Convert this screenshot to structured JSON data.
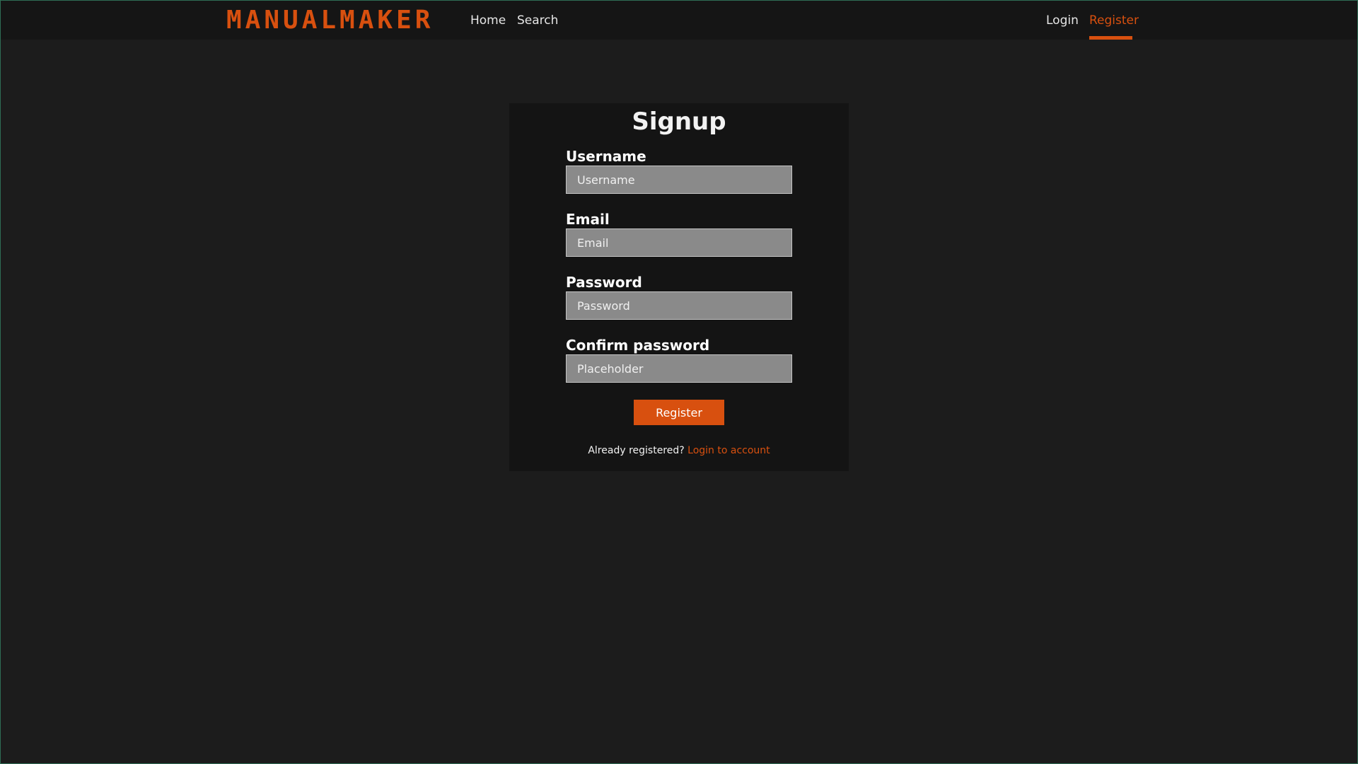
{
  "navbar": {
    "logo": "MANUALMAKER",
    "links": {
      "home": "Home",
      "search": "Search",
      "login": "Login",
      "register": "Register"
    },
    "active": "Register"
  },
  "signup": {
    "title": "Signup",
    "fields": {
      "username": {
        "label": "Username",
        "placeholder": "Username",
        "value": ""
      },
      "email": {
        "label": "Email",
        "placeholder": "Email",
        "value": ""
      },
      "password": {
        "label": "Password",
        "placeholder": "Password",
        "value": ""
      },
      "confirm": {
        "label": "Confirm password",
        "placeholder": "Placeholder",
        "value": ""
      }
    },
    "submit_label": "Register",
    "already_text": "Already registered?",
    "login_link": "Login to account"
  },
  "colors": {
    "accent": "#d8500f",
    "background": "#1c1c1c",
    "navbar": "#151515",
    "card": "#141414",
    "input": "#8a8a8a"
  }
}
